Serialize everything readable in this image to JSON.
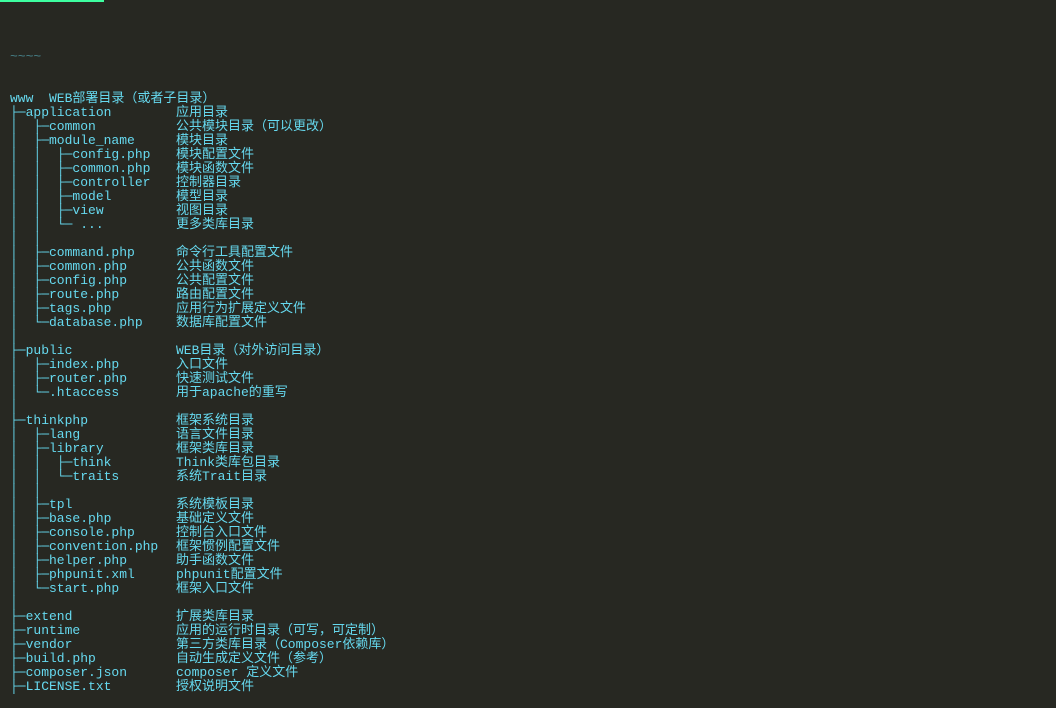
{
  "header_dim": "~~~~",
  "lines": [
    {
      "tree": "www  WEB部署目录（或者子目录）",
      "desc": ""
    },
    {
      "tree": "├─application",
      "desc": "应用目录"
    },
    {
      "tree": "│  ├─common",
      "desc": "公共模块目录（可以更改）"
    },
    {
      "tree": "│  ├─module_name",
      "desc": "模块目录"
    },
    {
      "tree": "│  │  ├─config.php",
      "desc": "模块配置文件"
    },
    {
      "tree": "│  │  ├─common.php",
      "desc": "模块函数文件"
    },
    {
      "tree": "│  │  ├─controller",
      "desc": "控制器目录"
    },
    {
      "tree": "│  │  ├─model",
      "desc": "模型目录"
    },
    {
      "tree": "│  │  ├─view",
      "desc": "视图目录"
    },
    {
      "tree": "│  │  └─ ...",
      "desc": "更多类库目录"
    },
    {
      "tree": "│  │",
      "desc": ""
    },
    {
      "tree": "│  ├─command.php",
      "desc": "命令行工具配置文件"
    },
    {
      "tree": "│  ├─common.php",
      "desc": "公共函数文件"
    },
    {
      "tree": "│  ├─config.php",
      "desc": "公共配置文件"
    },
    {
      "tree": "│  ├─route.php",
      "desc": "路由配置文件"
    },
    {
      "tree": "│  ├─tags.php",
      "desc": "应用行为扩展定义文件"
    },
    {
      "tree": "│  └─database.php",
      "desc": "数据库配置文件"
    },
    {
      "tree": "│",
      "desc": ""
    },
    {
      "tree": "├─public",
      "desc": "WEB目录（对外访问目录）"
    },
    {
      "tree": "│  ├─index.php",
      "desc": "入口文件"
    },
    {
      "tree": "│  ├─router.php",
      "desc": "快速测试文件"
    },
    {
      "tree": "│  └─.htaccess",
      "desc": "用于apache的重写"
    },
    {
      "tree": "│",
      "desc": ""
    },
    {
      "tree": "├─thinkphp",
      "desc": "框架系统目录"
    },
    {
      "tree": "│  ├─lang",
      "desc": "语言文件目录"
    },
    {
      "tree": "│  ├─library",
      "desc": "框架类库目录"
    },
    {
      "tree": "│  │  ├─think",
      "desc": "Think类库包目录"
    },
    {
      "tree": "│  │  └─traits",
      "desc": "系统Trait目录"
    },
    {
      "tree": "│  │",
      "desc": ""
    },
    {
      "tree": "│  ├─tpl",
      "desc": "系统模板目录"
    },
    {
      "tree": "│  ├─base.php",
      "desc": "基础定义文件"
    },
    {
      "tree": "│  ├─console.php",
      "desc": "控制台入口文件"
    },
    {
      "tree": "│  ├─convention.php",
      "desc": "框架惯例配置文件"
    },
    {
      "tree": "│  ├─helper.php",
      "desc": "助手函数文件"
    },
    {
      "tree": "│  ├─phpunit.xml",
      "desc": "phpunit配置文件"
    },
    {
      "tree": "│  └─start.php",
      "desc": "框架入口文件"
    },
    {
      "tree": "│",
      "desc": ""
    },
    {
      "tree": "├─extend",
      "desc": "扩展类库目录"
    },
    {
      "tree": "├─runtime",
      "desc": "应用的运行时目录（可写，可定制）"
    },
    {
      "tree": "├─vendor",
      "desc": "第三方类库目录（Composer依赖库）"
    },
    {
      "tree": "├─build.php",
      "desc": "自动生成定义文件（参考）"
    },
    {
      "tree": "├─composer.json",
      "desc": "composer 定义文件"
    },
    {
      "tree": "├─LICENSE.txt",
      "desc": "授权说明文件"
    }
  ]
}
